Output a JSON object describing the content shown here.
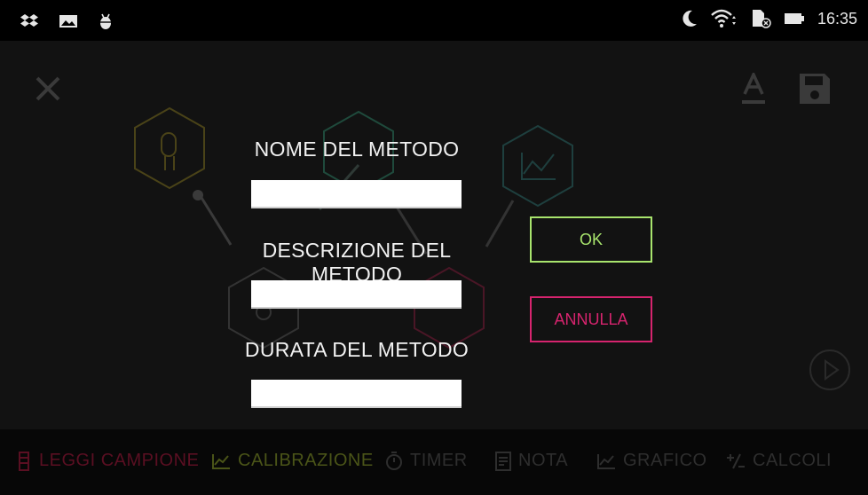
{
  "status_bar": {
    "time": "16:35",
    "left_icons": [
      "dropbox-icon",
      "gallery-icon",
      "android-debug-icon"
    ],
    "right_icons": [
      "moon-icon",
      "wifi-icon",
      "sim-card-icon",
      "battery-icon"
    ]
  },
  "app": {
    "top_bar": {
      "close_icon": "close-icon",
      "font_icon": "font-icon",
      "save_icon": "save-icon"
    },
    "play_icon": "play-icon",
    "bottom_nav": [
      {
        "label": "LEGGI CAMPIONE",
        "icon": "flask-icon",
        "color": "#6a0f26"
      },
      {
        "label": "CALIBRAZIONE",
        "icon": "chart-line-icon",
        "color": "#7a8a2a"
      },
      {
        "label": "TIMER",
        "icon": "timer-icon",
        "color": "#3a3a3a"
      },
      {
        "label": "NOTA",
        "icon": "note-icon",
        "color": "#3a3a3a"
      },
      {
        "label": "GRAFICO",
        "icon": "graph-icon",
        "color": "#3a3a3a"
      },
      {
        "label": "CALCOLI",
        "icon": "plus-minus-icon",
        "color": "#3a3a3a"
      }
    ]
  },
  "dialog": {
    "name_label": "NOME DEL METODO",
    "name_value": "",
    "description_label": "DESCRIZIONE DEL METODO",
    "description_value": "",
    "duration_label": "DURATA DEL METODO",
    "duration_value": "",
    "ok_label": "OK",
    "cancel_label": "ANNULLA"
  },
  "colors": {
    "ok": "#a8e46d",
    "cancel": "#d6246e",
    "sensor": "#c5b03a",
    "teal": "#2fa887",
    "chart": "#2fa8a0",
    "pink": "#c0305a"
  }
}
